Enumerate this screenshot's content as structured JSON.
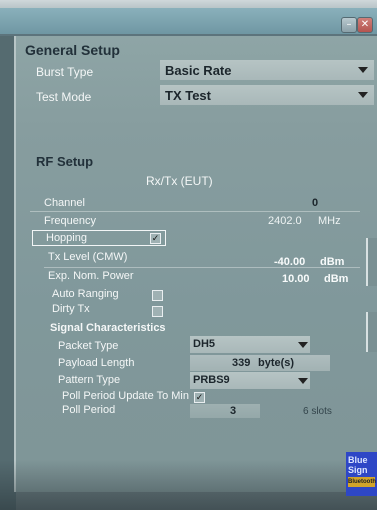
{
  "window": {
    "minimize_icon": "minimize-icon",
    "close_icon": "close-icon",
    "minimize_glyph": "–",
    "close_glyph": "✕"
  },
  "general_setup": {
    "title": "General Setup",
    "burst_type": {
      "label": "Burst Type",
      "value": "Basic Rate"
    },
    "test_mode": {
      "label": "Test Mode",
      "value": "TX Test"
    }
  },
  "rf_setup": {
    "title": "RF Setup",
    "subtitle": "Rx/Tx (EUT)",
    "channel": {
      "label": "Channel",
      "value": "0"
    },
    "frequency": {
      "label": "Frequency",
      "value": "2402.0",
      "unit": "MHz"
    },
    "hopping": {
      "label": "Hopping",
      "checked": true,
      "mark": "✓"
    },
    "tx_level": {
      "label": "Tx Level (CMW)",
      "value": "-40.00",
      "unit": "dBm"
    },
    "exp_nom_power": {
      "label": "Exp. Nom. Power",
      "value": "10.00",
      "unit": "dBm"
    },
    "auto_ranging": {
      "label": "Auto Ranging",
      "checked": false
    },
    "dirty_tx": {
      "label": "Dirty Tx",
      "checked": false
    }
  },
  "signal_characteristics": {
    "title": "Signal Characteristics",
    "packet_type": {
      "label": "Packet Type",
      "value": "DH5"
    },
    "payload_length": {
      "label": "Payload Length",
      "value": "339",
      "unit": "byte(s)"
    },
    "pattern_type": {
      "label": "Pattern Type",
      "value": "PRBS9"
    },
    "poll_period_update": {
      "label": "Poll Period Update To Min",
      "checked": true,
      "mark": "✓"
    },
    "poll_period": {
      "label": "Poll Period",
      "value": "3",
      "unit": "6 slots"
    }
  },
  "corner_badge": {
    "line1": "Blue",
    "line2": "Sign",
    "line3": "Bluetooth"
  }
}
